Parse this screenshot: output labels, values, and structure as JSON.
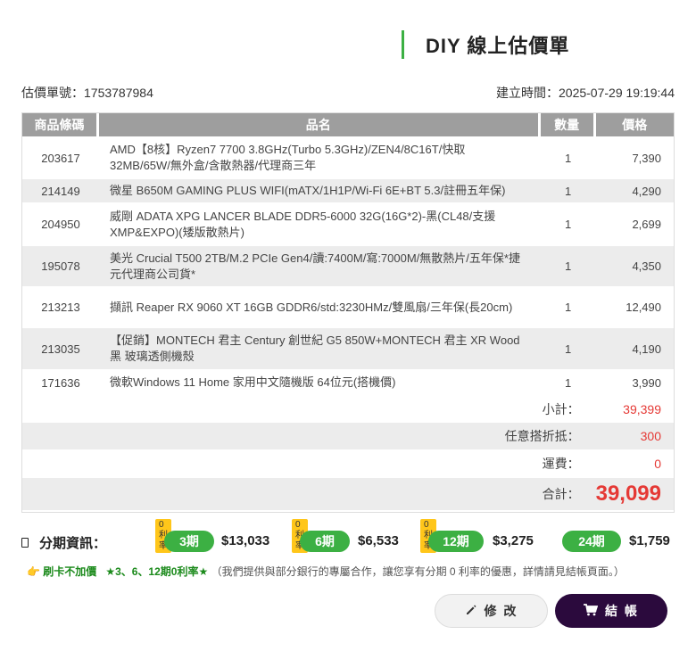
{
  "header": {
    "title": "DIY 線上估價單"
  },
  "meta": {
    "quote_no": "估價單號：1753787984",
    "created": "建立時間：2025-07-29 19:19:44"
  },
  "table": {
    "headers": {
      "code": "商品條碼",
      "name": "品名",
      "qty": "數量",
      "price": "價格"
    },
    "rows": [
      {
        "code": "203617",
        "name": "AMD【8核】Ryzen7 7700 3.8GHz(Turbo 5.3GHz)/ZEN4/8C16T/快取32MB/65W/無外盒/含散熱器/代理商三年",
        "qty": "1",
        "price": "7,390"
      },
      {
        "code": "214149",
        "name": "微星 B650M GAMING PLUS WIFI(mATX/1H1P/Wi-Fi 6E+BT 5.3/註冊五年保)",
        "qty": "1",
        "price": "4,290"
      },
      {
        "code": "204950",
        "name": "威剛 ADATA XPG LANCER BLADE DDR5-6000 32G(16G*2)-黑(CL48/支援XMP&EXPO)(矮版散熱片)",
        "qty": "1",
        "price": "2,699"
      },
      {
        "code": "195078",
        "name": "美光 Crucial T500 2TB/M.2 PCIe Gen4/讀:7400M/寫:7000M/無散熱片/五年保*捷元代理商公司貨*",
        "qty": "1",
        "price": "4,350"
      },
      {
        "code": "213213",
        "name": "擷訊 Reaper RX 9060 XT 16GB GDDR6/std:3230HMz/雙風扇/三年保(長20cm)",
        "qty": "1",
        "price": "12,490"
      },
      {
        "code": "213035",
        "name": "【促銷】MONTECH 君主 Century 創世紀 G5 850W+MONTECH 君主 XR Wood 黑 玻璃透側機殼",
        "qty": "1",
        "price": "4,190"
      },
      {
        "code": "171636",
        "name": "微軟Windows 11 Home 家用中文隨機版 64位元(搭機價)",
        "qty": "1",
        "price": "3,990"
      }
    ],
    "summary": {
      "subtotal_label": "小計：",
      "subtotal": "39,399",
      "discount_label": "任意搭折抵：",
      "discount": "300",
      "shipping_label": "運費：",
      "shipping": "0",
      "total_label": "合計：",
      "total": "39,099"
    }
  },
  "installment": {
    "label": "分期資訊：",
    "plans": [
      {
        "badge": "0利率",
        "term": "3期",
        "amount": "$13,033"
      },
      {
        "badge": "0利率",
        "term": "6期",
        "amount": "$6,533"
      },
      {
        "badge": "0利率",
        "term": "12期",
        "amount": "$3,275"
      },
      {
        "badge": "",
        "term": "24期",
        "amount": "$1,759"
      }
    ]
  },
  "promo": {
    "hand": "👉",
    "part1": "刷卡不加價",
    "part2": "★3、6、12期0利率★",
    "part3": "（我們提供與部分銀行的專屬合作，讓您享有分期 0 利率的優惠，詳情請見結帳頁面。）"
  },
  "buttons": {
    "edit": "修 改",
    "checkout": "結 帳"
  },
  "colors": {
    "accent_green": "#3cb043",
    "price_red": "#e53935",
    "checkout_bg": "#2b0a3d",
    "badge_yellow": "#ffc61a"
  },
  "icons": {
    "edit": "pencil-icon",
    "checkout": "cart-icon",
    "installment": "card-icon"
  }
}
